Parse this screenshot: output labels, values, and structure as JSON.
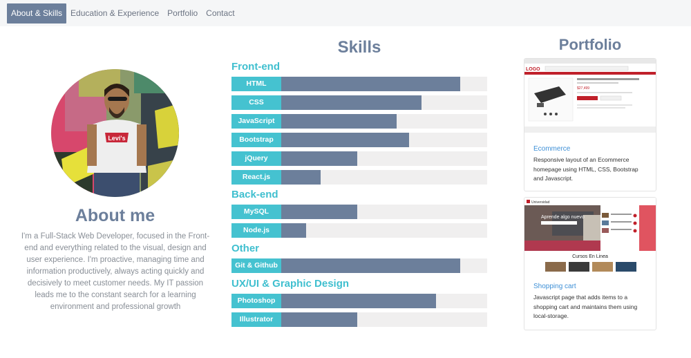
{
  "nav": {
    "items": [
      {
        "label": "About & Skills",
        "active": true
      },
      {
        "label": "Education & Experience",
        "active": false
      },
      {
        "label": "Portfolio",
        "active": false
      },
      {
        "label": "Contact",
        "active": false
      }
    ]
  },
  "about": {
    "title": "About me",
    "text": "I'm a Full-Stack Web Developer, focused in the Front-end and everything related to the visual, design and user experience. I'm proactive, managing time and information productively, always acting quickly and decisively to meet customer needs. My IT passion leads me to the constant search for a learning environment and professional growth",
    "avatar_shirt_text": "Levi's"
  },
  "skills": {
    "title": "Skills",
    "sections": [
      {
        "title": "Front-end",
        "items": [
          {
            "label": "HTML",
            "level": 0.87
          },
          {
            "label": "CSS",
            "level": 0.68
          },
          {
            "label": "JavaScript",
            "level": 0.56
          },
          {
            "label": "Bootstrap",
            "level": 0.62
          },
          {
            "label": "jQuery",
            "level": 0.37
          },
          {
            "label": "React.js",
            "level": 0.19
          }
        ]
      },
      {
        "title": "Back-end",
        "items": [
          {
            "label": "MySQL",
            "level": 0.37
          },
          {
            "label": "Node.js",
            "level": 0.12
          }
        ]
      },
      {
        "title": "Other",
        "items": [
          {
            "label": "Git & Github",
            "level": 0.87
          }
        ]
      },
      {
        "title": "UX/UI & Graphic Design",
        "items": [
          {
            "label": "Photoshop",
            "level": 0.75
          },
          {
            "label": "Illustrator",
            "level": 0.37
          }
        ]
      }
    ]
  },
  "portfolio": {
    "title": "Portfolio",
    "cards": [
      {
        "link": "Ecommerce",
        "description": "Responsive layout of an Ecommerce homepage using HTML, CSS, Bootstrap and Javascript.",
        "thumb": {
          "logo": "LOGO",
          "price": "$27,499"
        }
      },
      {
        "link": "Shopping cart",
        "description": "Javascript page that adds items to a shopping cart and maintains them using local-storage.",
        "thumb": {
          "brand": "Universidad",
          "hero": "Aprende algo nuevo",
          "section": "Cursos En Linea"
        }
      }
    ]
  },
  "colors": {
    "accent": "#45c2d0",
    "slate": "#6c7f9b",
    "track": "#f0efef",
    "link": "#3d8fd6"
  }
}
